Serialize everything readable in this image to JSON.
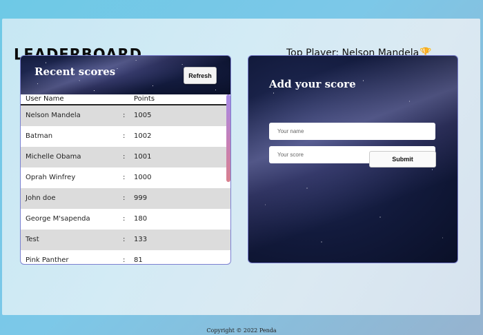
{
  "header": {
    "logo": "Leaderboard",
    "top_player_text": "Top Player: Nelson Mandela",
    "top_player_icon": "trophy-icon"
  },
  "scores": {
    "title": "Recent scores",
    "refresh_label": "Refresh",
    "columns": [
      "User Name",
      "Points"
    ],
    "rows": [
      {
        "name": "Nelson Mandela",
        "sep": ":",
        "points": "1005"
      },
      {
        "name": "Batman",
        "sep": ":",
        "points": "1002"
      },
      {
        "name": "Michelle Obama",
        "sep": ":",
        "points": "1001"
      },
      {
        "name": "Oprah Winfrey",
        "sep": ":",
        "points": "1000"
      },
      {
        "name": "John doe",
        "sep": ":",
        "points": "999"
      },
      {
        "name": "George M'sapenda",
        "sep": ":",
        "points": "180"
      },
      {
        "name": "Test",
        "sep": ":",
        "points": "133"
      },
      {
        "name": "Pink Panther",
        "sep": ":",
        "points": "81"
      }
    ]
  },
  "add_score": {
    "title": "Add your score",
    "name_placeholder": "Your name",
    "score_placeholder": "Your score",
    "submit_label": "Submit"
  },
  "footer": {
    "text": "Copyright © 2022 Penda"
  },
  "colors": {
    "row_shade": "#dcdcdc",
    "card_bg": "#0e1735",
    "accent_scrollbar": "#c67fb6",
    "trophy": "#d69a0c"
  }
}
